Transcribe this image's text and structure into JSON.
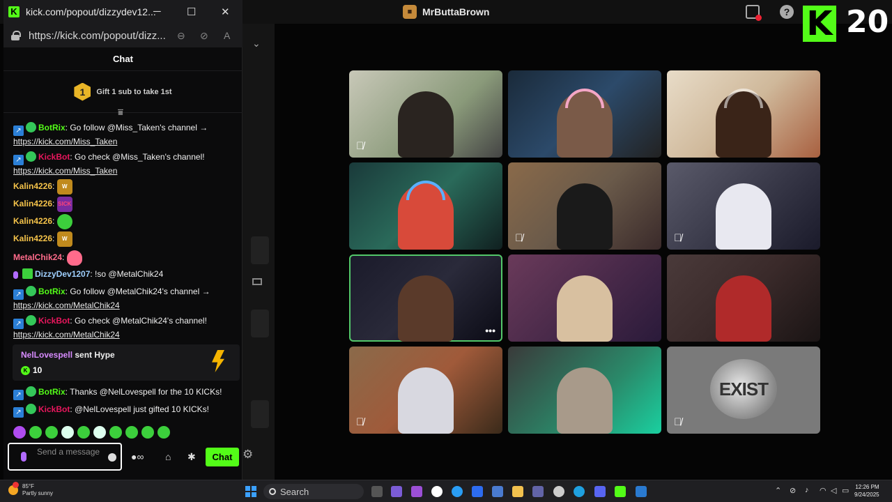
{
  "window": {
    "title": "kick.com/popout/dizzydev12...",
    "url": "https://kick.com/popout/dizz...",
    "minimize": "─",
    "maximize": "☐",
    "close": "✕"
  },
  "chat": {
    "header": "Chat",
    "pinned": {
      "rank": "1",
      "text": "Gift 1 sub to take 1st"
    },
    "messages": [
      {
        "user": "BotRix",
        "user_color": "#53fc18",
        "text": ": Go follow @Miss_Taken's channel →",
        "link": "https://kick.com/Miss_Taken"
      },
      {
        "user": "KickBot",
        "user_color": "#e8175d",
        "text": ": Go check @Miss_Taken's channel!",
        "link": "https://kick.com/Miss_Taken"
      },
      {
        "user": "Kalin4226",
        "user_color": "#f5c34a",
        "emote": "W"
      },
      {
        "user": "Kalin4226",
        "user_color": "#f5c34a",
        "emote": "SICK"
      },
      {
        "user": "Kalin4226",
        "user_color": "#f5c34a",
        "emote": "green"
      },
      {
        "user": "Kalin4226",
        "user_color": "#f5c34a",
        "emote": "W"
      },
      {
        "user": "MetalChik24",
        "user_color": "#ff6b8b",
        "emote": "pink"
      },
      {
        "user": "DizzyDev1207",
        "user_color": "#9fd0ff",
        "text": ": !so @MetalChik24"
      },
      {
        "user": "BotRix",
        "user_color": "#53fc18",
        "text": ": Go follow @MetalChik24's channel →",
        "link": "https://kick.com/MetalChik24"
      },
      {
        "user": "KickBot",
        "user_color": "#e8175d",
        "text": ": Go check @MetalChik24's channel!",
        "link": "https://kick.com/MetalChik24"
      },
      {
        "user": "BotRix",
        "user_color": "#53fc18",
        "text": ": Thanks @NelLovespell for the 10 KICKs!"
      },
      {
        "user": "KickBot",
        "user_color": "#e8175d",
        "text": ": @NelLovespell just gifted 10 KICKs!"
      }
    ],
    "hype": {
      "user": "NelLovespell",
      "action": " sent Hype",
      "amount": "10"
    },
    "emote_w": "W",
    "emote_sick": "SICK",
    "input_placeholder": "Send a message",
    "send_label": "Chat"
  },
  "app": {
    "title": "MrButtaBrown",
    "kick_logo": "K",
    "kick_count": "20",
    "help": "?",
    "exist_logo": "EXIST"
  },
  "taskbar": {
    "temp": "85°F",
    "weather": "Partly sunny",
    "search": "Search",
    "time": "12:26 PM",
    "date": "9/24/2025"
  }
}
